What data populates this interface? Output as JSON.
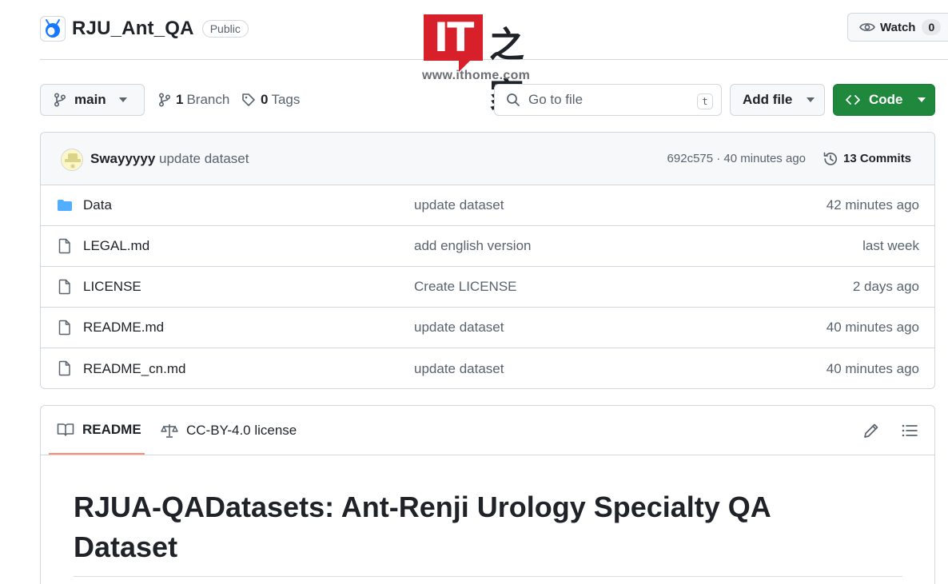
{
  "repo": {
    "name": "RJU_Ant_QA",
    "visibility": "Public",
    "watch_label": "Watch",
    "watch_count": "0"
  },
  "watermark": {
    "logo_text": "IT",
    "chars": "之家",
    "url": "www.ithome.com"
  },
  "toolbar": {
    "branch": "main",
    "branches_count": "1",
    "branches_label": "Branch",
    "tags_count": "0",
    "tags_label": "Tags",
    "search_placeholder": "Go to file",
    "search_shortcut": "t",
    "add_file_label": "Add file",
    "code_label": "Code"
  },
  "latest_commit": {
    "author": "Swayyyyy",
    "message": "update dataset",
    "meta": "692c575 · 40 minutes ago",
    "commits_label": "13 Commits"
  },
  "files": [
    {
      "type": "folder",
      "name": "Data",
      "commit": "update dataset",
      "age": "42 minutes ago"
    },
    {
      "type": "file",
      "name": "LEGAL.md",
      "commit": "add english version",
      "age": "last week"
    },
    {
      "type": "file",
      "name": "LICENSE",
      "commit": "Create LICENSE",
      "age": "2 days ago"
    },
    {
      "type": "file",
      "name": "README.md",
      "commit": "update dataset",
      "age": "40 minutes ago"
    },
    {
      "type": "file",
      "name": "README_cn.md",
      "commit": "update dataset",
      "age": "40 minutes ago"
    }
  ],
  "readme": {
    "tab_readme": "README",
    "tab_license": "CC-BY-4.0 license",
    "title": "RJUA-QADatasets: Ant-Renji Urology Specialty QA Dataset"
  },
  "colors": {
    "accent_green": "#1f883d",
    "folder_blue": "#54aeff",
    "tab_underline": "#fd8c73",
    "border": "#d0d7de"
  }
}
